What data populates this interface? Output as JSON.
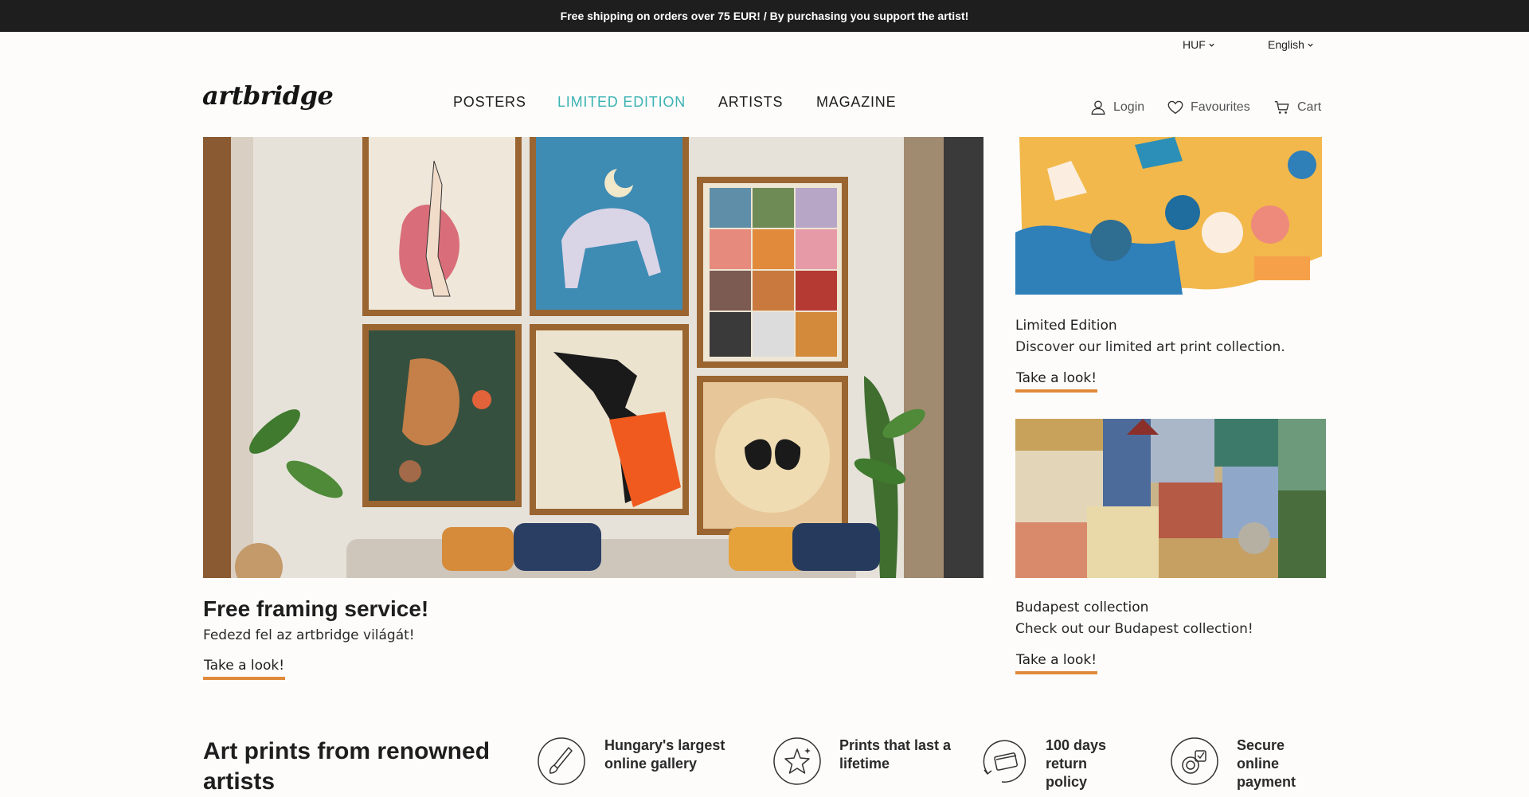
{
  "announcement": "Free shipping on orders over 75 EUR! / By purchasing you support the artist!",
  "utility": {
    "currency": "HUF",
    "language": "English"
  },
  "brand": {
    "logo": "artbridge"
  },
  "nav": [
    "POSTERS",
    "LIMITED EDITION",
    "ARTISTS",
    "MAGAZINE"
  ],
  "nav_active": "LIMITED EDITION",
  "account": {
    "login": "Login",
    "favourites": "Favourites",
    "cart": "Cart"
  },
  "hero": {
    "title": "Free framing service!",
    "subtitle": "Fedezd fel az artbridge világát!",
    "cta": "Take a look!"
  },
  "promos": [
    {
      "title": "Limited Edition",
      "subtitle": "Discover our limited art print collection.",
      "cta": "Take a look!"
    },
    {
      "title": "Budapest collection",
      "subtitle": "Check out our Budapest collection!",
      "cta": "Take a look!"
    }
  ],
  "intro": {
    "title": "Art prints from renowned artists"
  },
  "features": [
    {
      "icon": "brush-icon",
      "text": "Hungary's largest online gallery"
    },
    {
      "icon": "sparkle-star-icon",
      "text": "Prints that last a lifetime"
    },
    {
      "icon": "return-card-icon",
      "text": "100 days return policy"
    },
    {
      "icon": "secure-payment-icon",
      "text": "Secure online payment"
    }
  ],
  "colors": {
    "accent": "#3bb3b3",
    "underline": "#e08a3c",
    "topbar": "#1e1e1e"
  }
}
